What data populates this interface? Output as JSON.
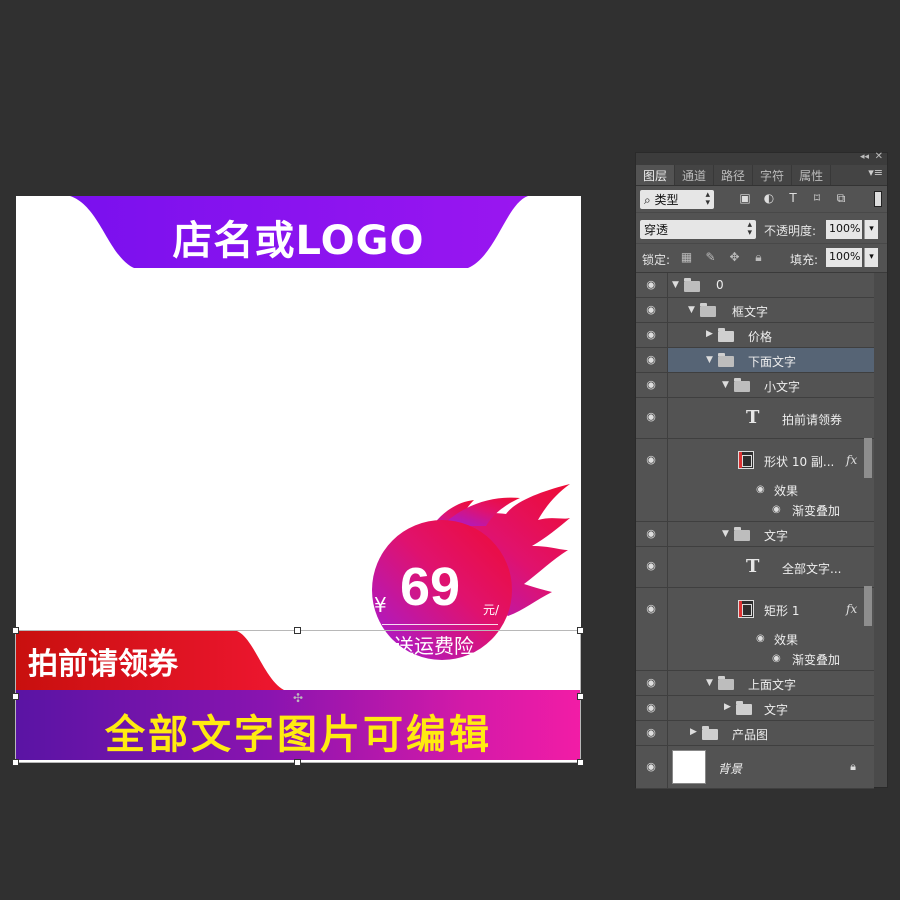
{
  "canvas": {
    "logo_text": "店名或LOGO",
    "price": {
      "currency": "¥",
      "amount": "69",
      "unit": "元/",
      "subtext": "送运费险"
    },
    "coupon_text": "拍前请领券",
    "bottom_text": "全部文字图片可编辑",
    "colors": {
      "purple": "#8a12f0",
      "red": "#e0102a",
      "magenta": "#f21ca6",
      "yellow": "#ffeb10"
    }
  },
  "panel": {
    "tabs": [
      "图层",
      "通道",
      "路径",
      "字符",
      "属性"
    ],
    "active_tab": "图层",
    "filter": "类型",
    "blend_mode": "穿透",
    "opacity_label": "不透明度:",
    "opacity": "100%",
    "lock_label": "锁定:",
    "fill_label": "填充:",
    "fill": "100%",
    "layers": [
      {
        "name": "0",
        "kind": "group-open"
      },
      {
        "name": "框文字",
        "kind": "group-open"
      },
      {
        "name": "价格",
        "kind": "group-closed"
      },
      {
        "name": "下面文字",
        "kind": "group-open",
        "selected": true
      },
      {
        "name": "小文字",
        "kind": "group-open"
      },
      {
        "name": "拍前请领券",
        "kind": "text"
      },
      {
        "name": "形状 10 副...",
        "kind": "shape",
        "fx": "fx",
        "effects": "效果",
        "effect": "渐变叠加"
      },
      {
        "name": "文字",
        "kind": "group-open"
      },
      {
        "name": "全部文字...",
        "kind": "text"
      },
      {
        "name": "矩形 1",
        "kind": "shape",
        "fx": "fx",
        "effects": "效果",
        "effect": "渐变叠加"
      },
      {
        "name": "上面文字",
        "kind": "group-open"
      },
      {
        "name": "文字",
        "kind": "group-closed"
      },
      {
        "name": "产品图",
        "kind": "group-closed"
      },
      {
        "name": "背景",
        "kind": "background"
      }
    ]
  }
}
